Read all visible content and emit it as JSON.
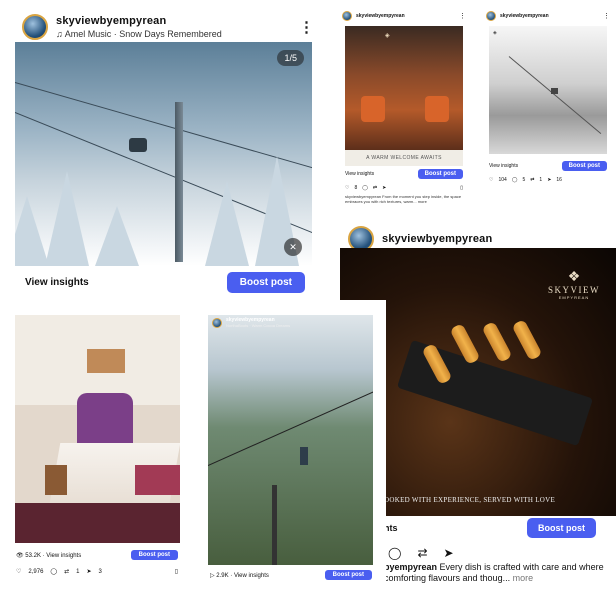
{
  "card1": {
    "username": "skyviewbyempyrean",
    "music": "Amel Music · Snow Days Remembered",
    "counter": "1/5",
    "insights": "View insights",
    "boost": "Boost post"
  },
  "card2": {
    "username": "skyviewbyempyrean",
    "banner": "A WARM WELCOME AWAITS",
    "insights": "View insights",
    "boost": "Boost post",
    "likes": "8",
    "caption": "skyviewbyempyrean From the moment you step inside, the space embraces you with rich textures, warm... more"
  },
  "card3": {
    "username": "skyviewbyempyrean",
    "insights": "View insights",
    "boost": "Boost post",
    "likes": "104",
    "comments": "5",
    "shares": "1",
    "sends": "16"
  },
  "card4": {
    "username": "skyviewbyempyrean",
    "brand_line1": "SKYVIEW",
    "brand_line2": "EMPYREAN",
    "tagline": "OOKED WITH EXPERIENCE, SERVED WITH LOVE",
    "insights": "ights",
    "boost": "Boost post",
    "caption_user": "byempyrean",
    "caption_text": "Every dish is crafted with care and where comforting flavours and thoug...",
    "more": "more"
  },
  "card5": {
    "views": "53.2K · View insights",
    "boost": "Boost post",
    "likes": "2,976",
    "shares": "1",
    "sends": "3"
  },
  "card6": {
    "username": "skyviewbyempyrean",
    "music": "NorthaBoots · Warm Cocoa Dreams",
    "views": "2.9K · View insights",
    "boost": "Boost post"
  }
}
